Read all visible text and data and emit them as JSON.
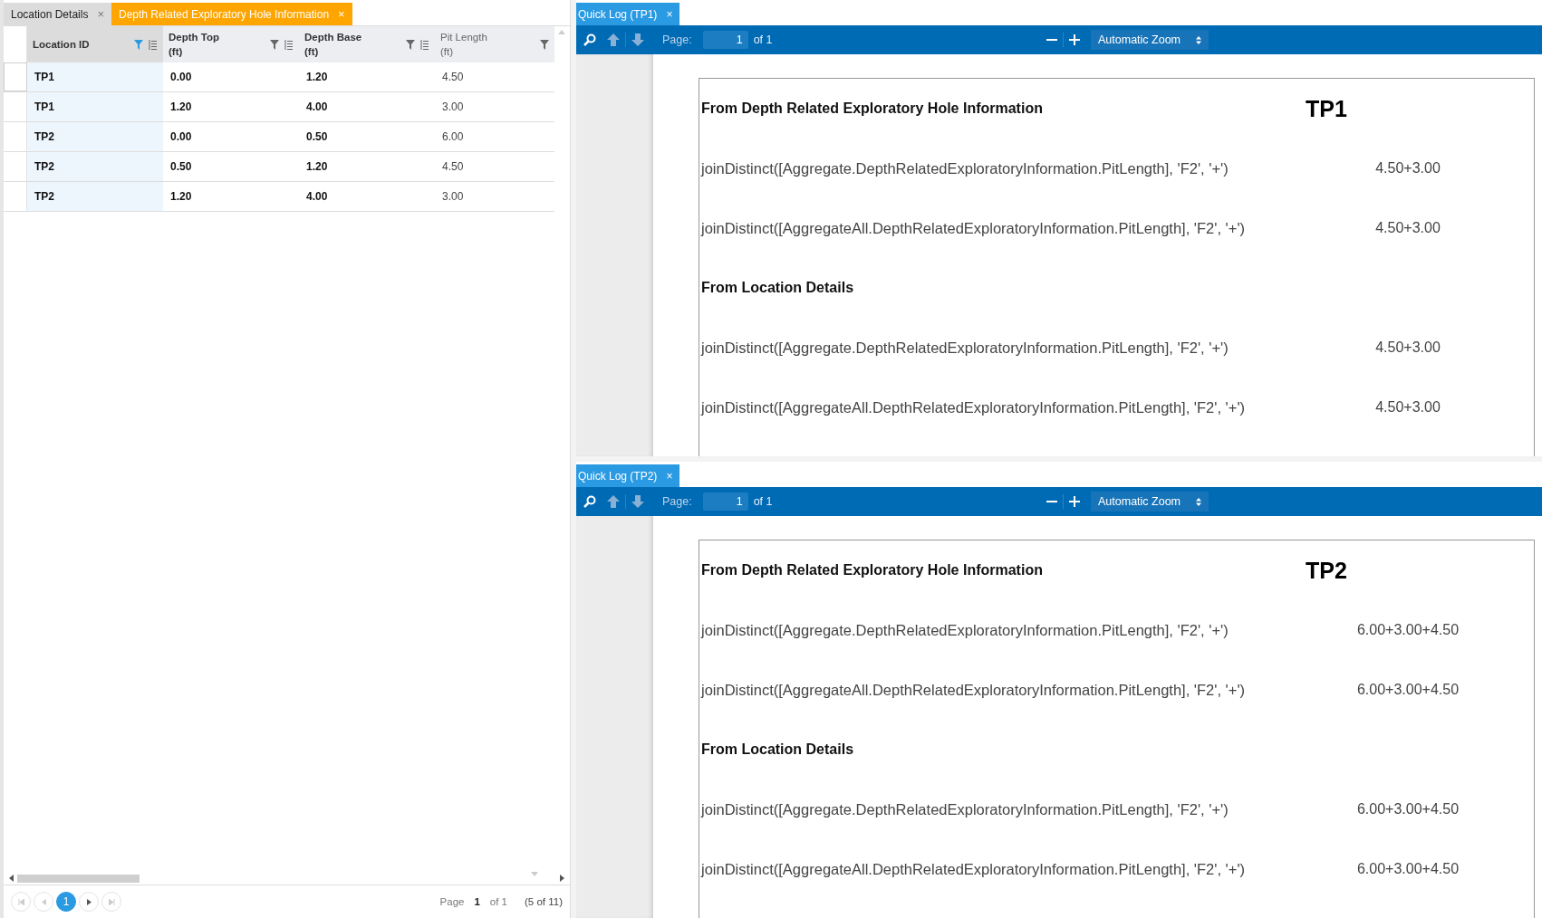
{
  "left_tabs": [
    {
      "label": "Location Details",
      "selected": false,
      "close": "×"
    },
    {
      "label": "Depth Related Exploratory Hole Information",
      "selected": true,
      "close": "×"
    }
  ],
  "grid": {
    "columns": [
      {
        "label": "Location ID",
        "bold": true,
        "filter_active": true,
        "sort_icon": true
      },
      {
        "label": "Depth Top",
        "unit": "(ft)",
        "bold": true,
        "filter_active": false,
        "sort_icon": true
      },
      {
        "label": "Depth Base",
        "unit": "(ft)",
        "bold": true,
        "filter_active": false,
        "sort_icon": true
      },
      {
        "label": "Pit Length",
        "unit": "(ft)",
        "bold": false,
        "filter_active": false,
        "sort_icon": false
      }
    ],
    "rows": [
      {
        "current": true,
        "cells": [
          "TP1",
          "0.00",
          "1.20",
          "4.50"
        ]
      },
      {
        "current": false,
        "cells": [
          "TP1",
          "1.20",
          "4.00",
          "3.00"
        ]
      },
      {
        "current": false,
        "cells": [
          "TP2",
          "0.00",
          "0.50",
          "6.00"
        ]
      },
      {
        "current": false,
        "cells": [
          "TP2",
          "0.50",
          "1.20",
          "4.50"
        ]
      },
      {
        "current": false,
        "cells": [
          "TP2",
          "1.20",
          "4.00",
          "3.00"
        ]
      }
    ]
  },
  "pager": {
    "pages": [
      {
        "label": "1",
        "selected": true
      }
    ],
    "page_label": "Page",
    "page": "1",
    "of": "of 1",
    "count": "(5 of 11)"
  },
  "viewers": [
    {
      "tab": "Quick Log (TP1)",
      "close": "×",
      "toolbar": {
        "page_label": "Page:",
        "page": "1",
        "of": "of 1",
        "zoom": "Automatic Zoom"
      },
      "document": {
        "title": "TP1",
        "sections": [
          {
            "heading": "From Depth Related Exploratory Hole Information",
            "lines": [
              {
                "formula": "joinDistinct([Aggregate.DepthRelatedExploratoryInformation.PitLength], 'F2', '+')",
                "value": "4.50+3.00"
              },
              {
                "formula": "joinDistinct([AggregateAll.DepthRelatedExploratoryInformation.PitLength], 'F2', '+')",
                "value": "4.50+3.00"
              }
            ]
          },
          {
            "heading": "From Location Details",
            "lines": [
              {
                "formula": "joinDistinct([Aggregate.DepthRelatedExploratoryInformation.PitLength], 'F2', '+')",
                "value": "4.50+3.00"
              },
              {
                "formula": "joinDistinct([AggregateAll.DepthRelatedExploratoryInformation.PitLength], 'F2', '+')",
                "value": "4.50+3.00"
              }
            ]
          }
        ]
      }
    },
    {
      "tab": "Quick Log (TP2)",
      "close": "×",
      "toolbar": {
        "page_label": "Page:",
        "page": "1",
        "of": "of 1",
        "zoom": "Automatic Zoom"
      },
      "document": {
        "title": "TP2",
        "sections": [
          {
            "heading": "From Depth Related Exploratory Hole Information",
            "lines": [
              {
                "formula": "joinDistinct([Aggregate.DepthRelatedExploratoryInformation.PitLength], 'F2', '+')",
                "value": "6.00+3.00+4.50"
              },
              {
                "formula": "joinDistinct([AggregateAll.DepthRelatedExploratoryInformation.PitLength], 'F2', '+')",
                "value": "6.00+3.00+4.50"
              }
            ]
          },
          {
            "heading": "From Location Details",
            "lines": [
              {
                "formula": "joinDistinct([Aggregate.DepthRelatedExploratoryInformation.PitLength], 'F2', '+')",
                "value": "6.00+3.00+4.50"
              },
              {
                "formula": "joinDistinct([AggregateAll.DepthRelatedExploratoryInformation.PitLength], 'F2', '+')",
                "value": "6.00+3.00+4.50"
              }
            ]
          }
        ]
      }
    }
  ]
}
